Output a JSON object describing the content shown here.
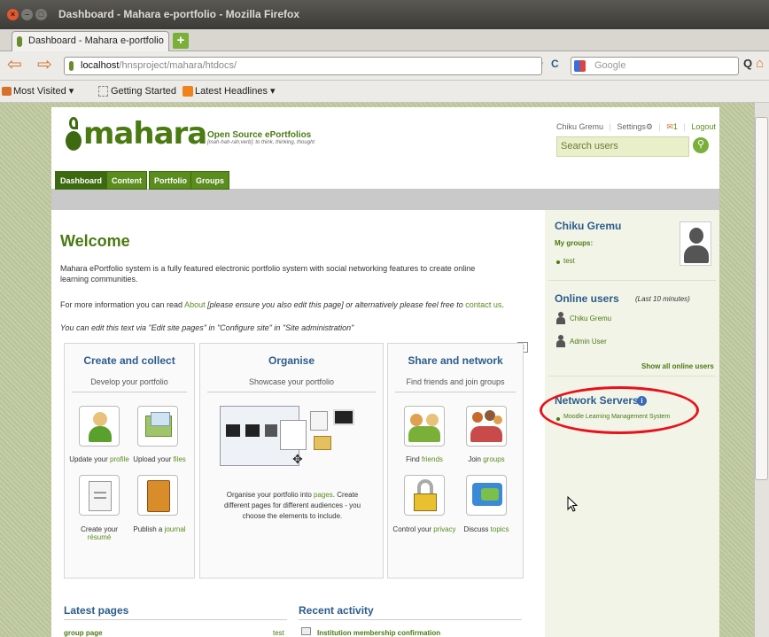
{
  "window": {
    "title": "Dashboard - Mahara e-portfolio - Mozilla Firefox"
  },
  "tab": {
    "label": "Dashboard - Mahara e-portfolio",
    "new_tab": "+"
  },
  "navbar": {
    "url_host": "localhost",
    "url_path": "/hnsproject/mahara/htdocs/",
    "search_placeholder": "Google"
  },
  "bookmarks": {
    "most_visited": "Most Visited ▾",
    "getting_started": "Getting Started",
    "latest_headlines": "Latest Headlines ▾"
  },
  "header": {
    "logo_text": "mahara",
    "tagline": "Open Source ePortfolios",
    "tagline_sub": "[mah-hah-rah;verb]: to think, thinking, thought",
    "user": "Chiku Gremu",
    "settings": "Settings",
    "inbox_count": "1",
    "logout": "Logout",
    "search_placeholder": "Search users"
  },
  "nav": [
    "Dashboard",
    "Content",
    "Portfolio",
    "Groups"
  ],
  "main": {
    "welcome": "Welcome",
    "intro": "Mahara ePortfolio system is a fully featured electronic portfolio system with social networking features to create online learning communities.",
    "more_pre": "For more information you can read ",
    "more_about": "About",
    "more_mid": " [please ensure you also edit this page] or alternatively please feel free to ",
    "more_contact": "contact us",
    "more_end": ".",
    "edit_note": "You can edit this text via \"Edit site pages\" in \"Configure site\" in \"Site administration\""
  },
  "panels": {
    "create": {
      "title": "Create and collect",
      "sub": "Develop your portfolio",
      "items": [
        {
          "pre": "Update your ",
          "link": "profile"
        },
        {
          "pre": "Upload your ",
          "link": "files"
        },
        {
          "pre": "Create your ",
          "link": "résumé"
        },
        {
          "pre": "Publish a ",
          "link": "journal"
        }
      ]
    },
    "organise": {
      "title": "Organise",
      "sub": "Showcase your portfolio",
      "text_pre": "Organise your portfolio into ",
      "text_link": "pages",
      "text_post": ". Create different pages for different audiences - you choose the elements to include."
    },
    "share": {
      "title": "Share and network",
      "sub": "Find friends and join groups",
      "items": [
        {
          "pre": "Find ",
          "link": "friends"
        },
        {
          "pre": "Join ",
          "link": "groups"
        },
        {
          "pre": "Control your ",
          "link": "privacy"
        },
        {
          "pre": "Discuss ",
          "link": "topics"
        }
      ]
    }
  },
  "bottom": {
    "latest_pages": "Latest pages",
    "page_name": "group page",
    "page_owner": "test",
    "recent_activity": "Recent activity",
    "activity_item": "Institution membership confirmation"
  },
  "sidebar": {
    "profile_name": "Chiku Gremu",
    "my_groups": "My groups:",
    "group_item": "test",
    "online_title": "Online users",
    "online_note": "(Last 10 minutes)",
    "online_users": [
      "Chiku Gremu",
      "Admin User"
    ],
    "show_all": "Show all online users",
    "network_title": "Network Servers",
    "network_item": "Moodle Learning Management System"
  },
  "colors": {
    "accent": "#5a8c1e",
    "annotation": "#e8121b"
  }
}
